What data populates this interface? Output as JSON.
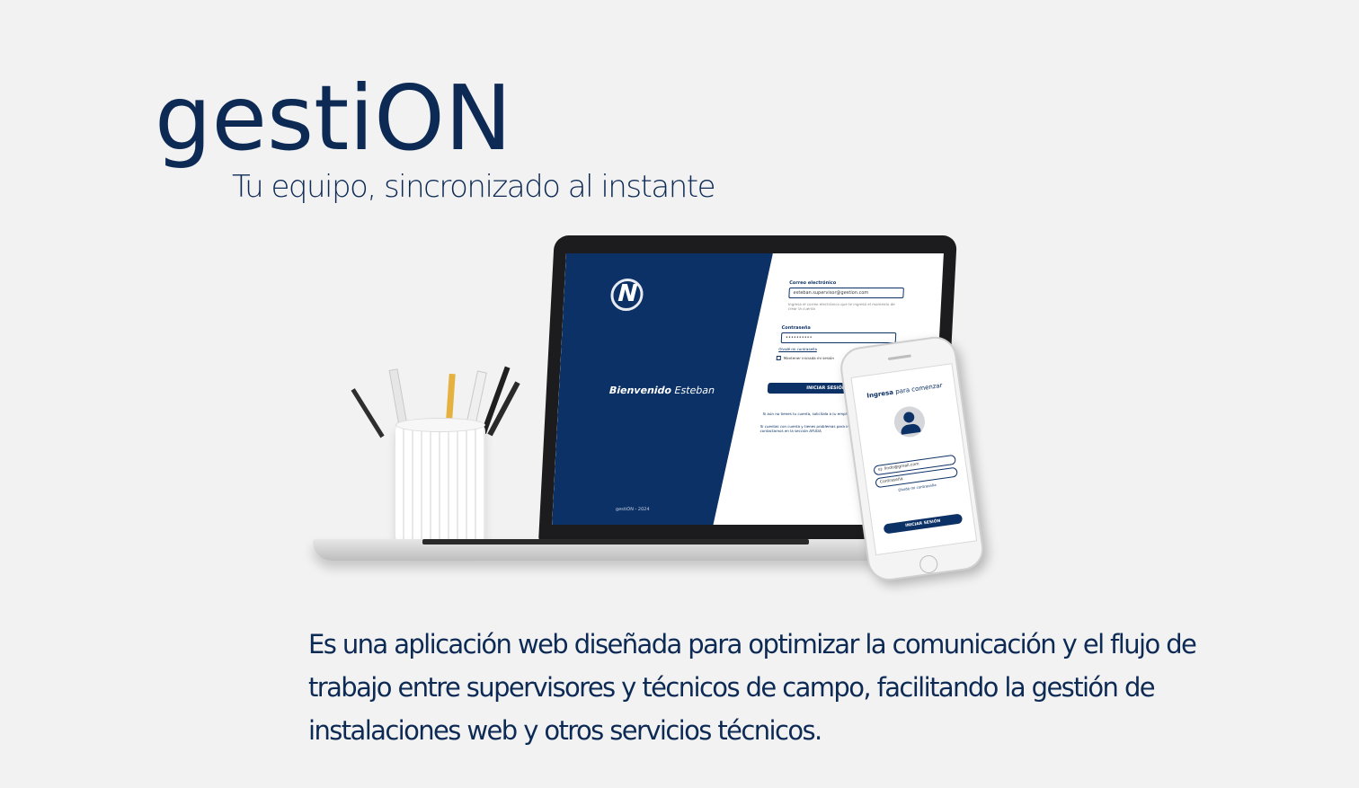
{
  "brand": {
    "title": "gestiON",
    "tagline": "Tu equipo, sincronizado al instante"
  },
  "description": "Es una aplicación web diseñada para optimizar la comunicación y el flujo de trabajo entre supervisores y técnicos de campo, facilitando la gestión de instalaciones web y otros servicios técnicos.",
  "laptop_screen": {
    "logo_letter": "N",
    "welcome_bold": "Bienvenido",
    "welcome_name": "Esteban",
    "footer": "gestiON - 2024",
    "email_label": "Correo electrónico",
    "email_value": "esteban.supervisor@gestion.com",
    "email_hint": "Ingresa el correo electrónico que te ingresó el momento de crear la cuenta",
    "password_label": "Contraseña",
    "password_value": "••••••••••",
    "forgot_password": "Olvidé mi contraseña",
    "keep_session": "Mantener iniciada mi sesión",
    "login_button": "INICIAR SESIÓN",
    "no_account_text": "Si aún no tienes tu cuenta, solicítala a tu empleador",
    "help_text": "Si cuentas con cuenta y tienes problemas para ingresar, no dudes contactarnos en la sección AYUDA"
  },
  "phone_screen": {
    "title_bold": "Ingresa",
    "title_rest": "para comenzar",
    "email_value": "ej: lindo@gmail.com",
    "password_placeholder": "Contraseña",
    "forgot_password": "Olvidé mi contraseña",
    "login_button": "INICIAR SESIÓN"
  },
  "colors": {
    "brand_navy": "#0d2a55",
    "screen_navy": "#0b3166",
    "background": "#f2f2f2"
  }
}
